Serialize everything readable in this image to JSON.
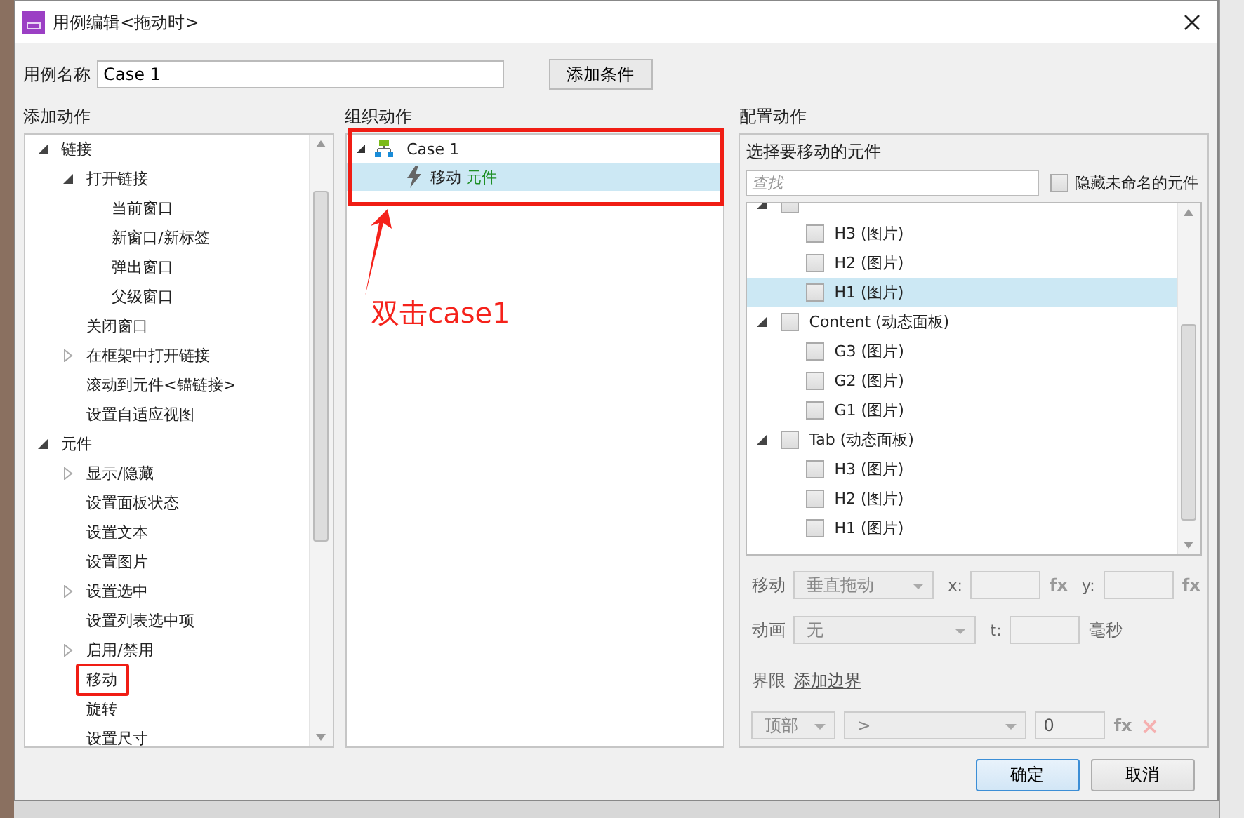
{
  "window": {
    "title": "用例编辑<拖动时>"
  },
  "case_name": {
    "label": "用例名称",
    "value": "Case 1",
    "add_condition_button": "添加条件"
  },
  "add_actions": {
    "heading": "添加动作",
    "items": [
      {
        "label": "链接",
        "expanded": true,
        "children": [
          {
            "label": "打开链接",
            "expanded": true,
            "children": [
              {
                "label": "当前窗口"
              },
              {
                "label": "新窗口/新标签"
              },
              {
                "label": "弹出窗口"
              },
              {
                "label": "父级窗口"
              }
            ]
          },
          {
            "label": "关闭窗口"
          },
          {
            "label": "在框架中打开链接",
            "expanded": false
          },
          {
            "label": "滚动到元件<锚链接>"
          },
          {
            "label": "设置自适应视图"
          }
        ]
      },
      {
        "label": "元件",
        "expanded": true,
        "children": [
          {
            "label": "显示/隐藏",
            "expanded": false
          },
          {
            "label": "设置面板状态"
          },
          {
            "label": "设置文本"
          },
          {
            "label": "设置图片"
          },
          {
            "label": "设置选中",
            "expanded": false
          },
          {
            "label": "设置列表选中项"
          },
          {
            "label": "启用/禁用",
            "expanded": false
          },
          {
            "label": "移动",
            "highlighted": true
          },
          {
            "label": "旋转"
          },
          {
            "label": "设置尺寸"
          }
        ]
      }
    ]
  },
  "organize_actions": {
    "heading": "组织动作",
    "highlighted": true,
    "cases": [
      {
        "label": "Case 1",
        "expanded": true,
        "actions": [
          {
            "action": "移动",
            "target": "元件",
            "selected": true
          }
        ]
      }
    ]
  },
  "annotation": {
    "note": "双击case1"
  },
  "configure_actions": {
    "heading": "配置动作",
    "subheading": "选择要移动的元件",
    "search": {
      "placeholder": "查找"
    },
    "hide_unnamed": {
      "label": "隐藏未命名的元件",
      "checked": false
    },
    "widgets": [
      {
        "expanded": true,
        "checked": false,
        "selected": false,
        "children": [
          {
            "label": "H3 (图片)",
            "checked": false,
            "selected": false
          },
          {
            "label": "H2 (图片)",
            "checked": false,
            "selected": false
          },
          {
            "label": "H1 (图片)",
            "checked": false,
            "selected": true
          }
        ]
      },
      {
        "label": "Content (动态面板)",
        "expanded": true,
        "checked": false,
        "selected": false,
        "children": [
          {
            "label": "G3 (图片)",
            "checked": false,
            "selected": false
          },
          {
            "label": "G2 (图片)",
            "checked": false,
            "selected": false
          },
          {
            "label": "G1 (图片)",
            "checked": false,
            "selected": false
          }
        ]
      },
      {
        "label": "Tab (动态面板)",
        "expanded": true,
        "checked": false,
        "selected": false,
        "children": [
          {
            "label": "H3 (图片)",
            "checked": false,
            "selected": false
          },
          {
            "label": "H2 (图片)",
            "checked": false,
            "selected": false
          },
          {
            "label": "H1 (图片)",
            "checked": false,
            "selected": false
          }
        ]
      }
    ],
    "form": {
      "disabled": true,
      "move": {
        "label": "移动",
        "mode": "垂直拖动",
        "x_label": "x:",
        "fx": "fx",
        "y_label": "y:",
        "fx_2": "fx"
      },
      "animation": {
        "label": "动画",
        "value": "无",
        "t_label": "t:",
        "unit": "毫秒"
      },
      "bounds": {
        "label": "界限",
        "link": "添加边界"
      },
      "bound_row": {
        "edge": "顶部",
        "operator": ">",
        "value": "0",
        "fx": "fx",
        "remove": "×"
      }
    }
  },
  "buttons": [
    {
      "label": "确定",
      "kind": "primary"
    },
    {
      "label": "取消",
      "kind": "normal"
    }
  ]
}
